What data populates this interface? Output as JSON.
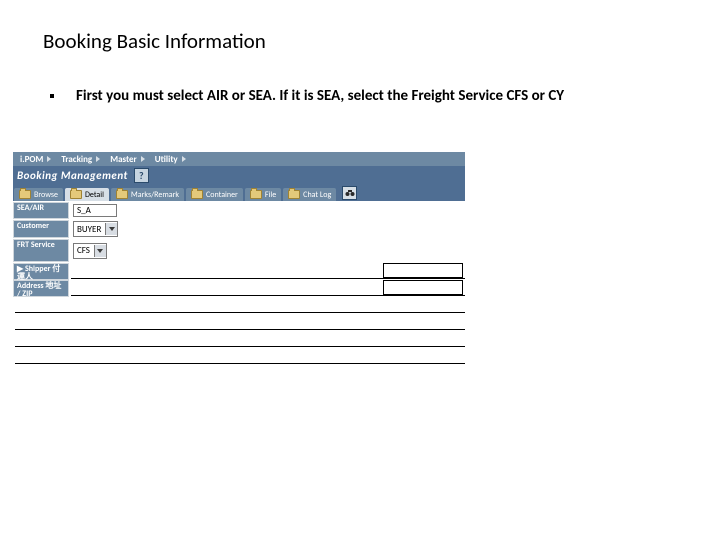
{
  "title": "Booking Basic Information",
  "bullet": "First you must select AIR or SEA.  If it is SEA, select the Freight Service CFS or CY",
  "menubar": [
    "i.POM",
    "Tracking",
    "Master",
    "Utility"
  ],
  "screen_title": "Booking Management",
  "help_char": "?",
  "tabs": [
    "Browse",
    "Detail",
    "Marks/Remark",
    "Container",
    "File",
    "Chat Log"
  ],
  "active_tab_index": 1,
  "fields": {
    "sea_air": {
      "label": "SEA/AIR",
      "value": "S_A"
    },
    "customer": {
      "label": "Customer",
      "value": "BUYER"
    },
    "frt_service": {
      "label": "FRT Service",
      "value": "CFS"
    },
    "shipper": {
      "label": "▶ Shipper 付運人"
    },
    "address": {
      "label": "Address 地址 / ZIP"
    }
  }
}
